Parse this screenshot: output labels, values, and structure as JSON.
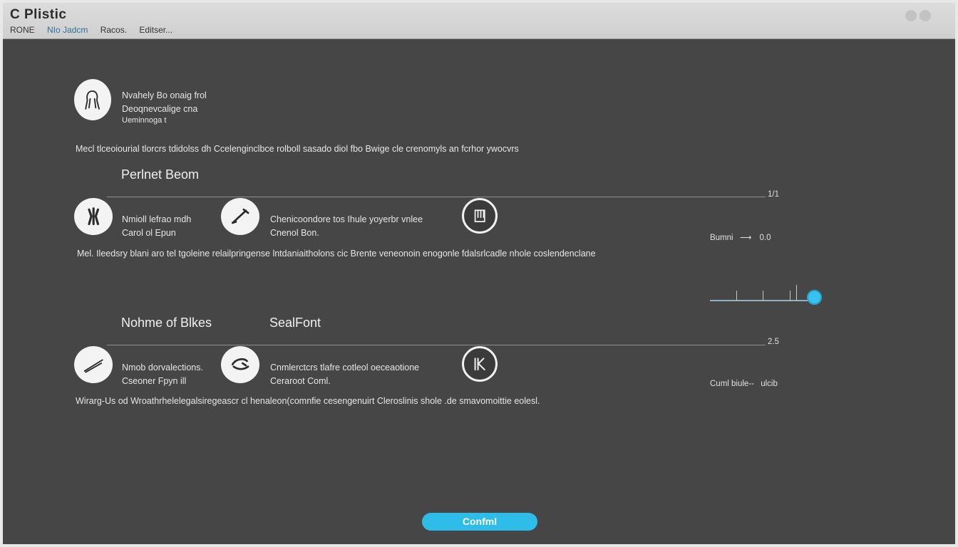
{
  "window": {
    "title": "C Plistic",
    "menu": [
      "RONE",
      "NIo Jadcm",
      "Racos.",
      "Editser..."
    ]
  },
  "profile": {
    "lines": [
      "Nvahely Bo onaig frol",
      "Deoqnevcalige cna",
      "Ueminnoga t"
    ],
    "description": "Mecl tlceoiourial tlorcrs tdidolss dh Ccelenginclbce rolboll sasado diol fbo Bwige cle crenomyls an fcrhor ywocvrs"
  },
  "section1": {
    "heading": "Perlnet Beom",
    "line_value": "1/1",
    "items": [
      {
        "line1": "Nmioll lefrao mdh",
        "line2": "Carol ol Epun"
      },
      {
        "line1": "Chenicoondore tos Ihule yoyerbr vnlee",
        "line2": "Cnenol Bon."
      }
    ],
    "side_label": "Bumni",
    "side_value": "0.0",
    "description": "Mel. Ileedsry blani aro tel tgoleine relailpringense lntdaniaitholons cic Brente veneonoin enogonle fdalsrlcadle nhole coslendenclane"
  },
  "section2": {
    "heading_left": "Nohme of Blkes",
    "heading_right": "SealFont",
    "line_value": "2.5",
    "items": [
      {
        "line1": "Nmob dorvalections.",
        "line2": "Cseoner Fpyn ill"
      },
      {
        "line1": "Cnmlerctcrs tlafre cotleol oeceaotione",
        "line2": "Ceraroot Coml."
      }
    ],
    "side_label": "Cuml biule--",
    "side_value": "ulcib",
    "description": "Wirarg-Us od Wroathrhelelegalsiregeascr cl henaleon(comnfie cesengenuirt Cleroslinis shole .de smavomoittie eolesl."
  },
  "slider": {
    "value": 1.0
  },
  "confirm_label": "Confml",
  "colors": {
    "accent": "#2ebde9",
    "background": "#464646",
    "titlebar": "#d6d6d6"
  }
}
